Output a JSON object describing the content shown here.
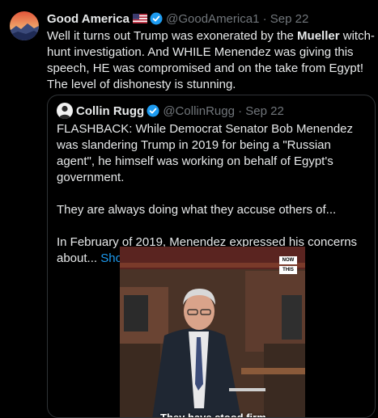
{
  "tweet": {
    "author_name": "Good America",
    "author_handle": "@GoodAmerica1",
    "separator": "·",
    "date": "Sep 22",
    "text_part1": "Well it turns out Trump was exonerated by the ",
    "text_bold": "Mueller",
    "text_part2": " witch-hunt investigation. And WHILE Menendez was giving this speech, HE was compromised and on the take from Egypt! The level of dishonesty is stunning."
  },
  "quote": {
    "author_name": "Collin Rugg",
    "author_handle": "@CollinRugg",
    "separator": "·",
    "date": "Sep 22",
    "paragraph1": "FLASHBACK: While Democrat Senator Bob Menendez was slandering Trump in 2019 for being a \"Russian agent\", he himself was working on behalf of Egypt's government.",
    "paragraph2": "They are always doing what they accuse others of...",
    "paragraph3": "In February of 2019, Menendez expressed his concerns about...",
    "show_more": "Show more",
    "video": {
      "badge_line1": "NOW",
      "badge_line2": "THIS",
      "caption": "They have stood firm"
    }
  },
  "colors": {
    "background": "#000000",
    "text": "#e7e9ea",
    "muted": "#71767b",
    "link": "#1d9bf0",
    "verified": "#1d9bf0"
  }
}
